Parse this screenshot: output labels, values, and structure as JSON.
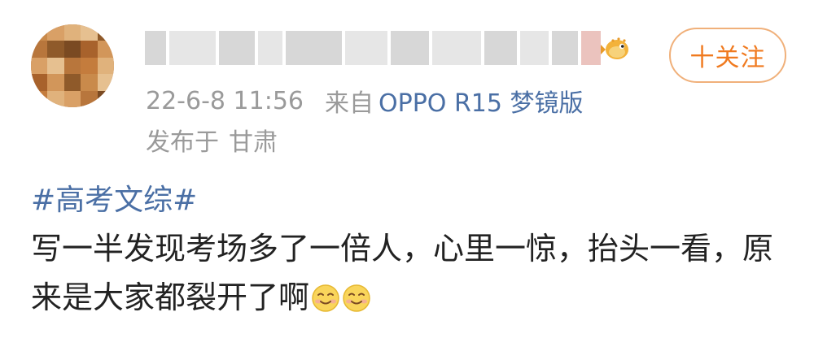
{
  "user": {
    "avatar_colors": [
      "#c98a4b",
      "#d9a066",
      "#8f5a2a",
      "#e0b27c",
      "#b8763c",
      "#a8622c",
      "#e6c090",
      "#c47c3d",
      "#7a4a22",
      "#d2965a"
    ],
    "name_blurred": true,
    "badge_icon": "fish-badge-icon"
  },
  "follow_button": {
    "label": "十关注"
  },
  "meta": {
    "timestamp": "22-6-8 11:56",
    "source_label": "来自",
    "device": "OPPO R15 梦镜版",
    "location_label": "发布于",
    "location": "甘肃"
  },
  "post": {
    "hashtag": "#高考文综#",
    "text": "写一半发现考场多了一倍人，心里一惊，抬头一看，原来是大家都裂开了啊",
    "emojis": [
      "smile-emoji-icon",
      "smile-emoji-icon"
    ]
  },
  "colors": {
    "link_blue": "#4a6fa5",
    "follow_orange": "#f07a1f",
    "meta_gray": "#9a9a9a"
  }
}
